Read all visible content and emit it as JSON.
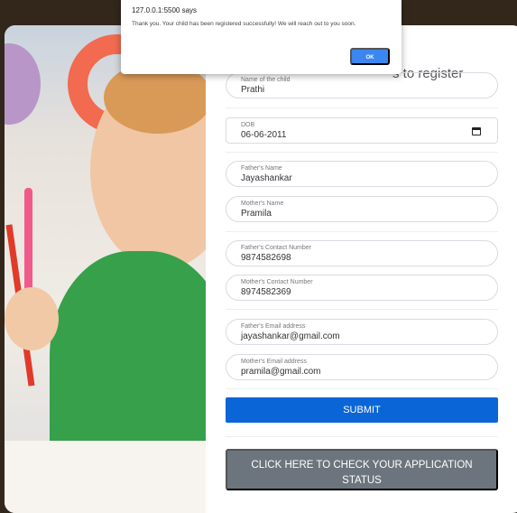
{
  "form": {
    "heading_visible": "s to register",
    "fields": [
      {
        "label": "Name of the child",
        "value": "Prathi"
      },
      {
        "label": "DOB",
        "value": "06-06-2011"
      },
      {
        "label": "Father's Name",
        "value": "Jayashankar"
      },
      {
        "label": "Mother's Name",
        "value": "Pramila"
      },
      {
        "label": "Father's Contact Number",
        "value": "9874582698"
      },
      {
        "label": "Mother's Contact Number",
        "value": "8974582369"
      },
      {
        "label": "Father's Email address",
        "value": "jayashankar@gmail.com"
      },
      {
        "label": "Mother's Email address",
        "value": "pramila@gmail.com"
      }
    ],
    "submit_label": "SUBMIT",
    "status_label": "CLICK HERE TO CHECK YOUR APPLICATION STATUS"
  },
  "alert": {
    "title": "127.0.0.1:5500 says",
    "message": "Thank you. Your child has been registered successfully! We will reach out to you soon.",
    "ok_label": "OK"
  },
  "colors": {
    "background": "#33271b",
    "submit": "#0a66d6",
    "status": "#6c757d",
    "ok": "#3b86f0"
  }
}
